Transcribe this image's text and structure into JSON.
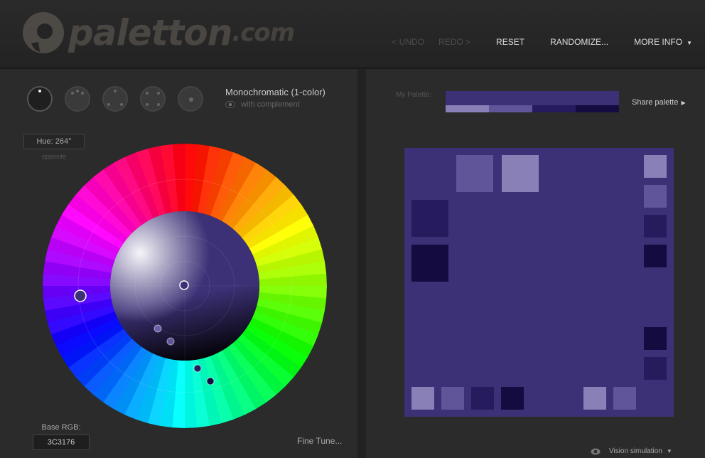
{
  "header": {
    "logo_text": "paletton",
    "logo_suffix": ".com",
    "nav": {
      "undo": "< UNDO",
      "redo": "REDO >",
      "reset": "RESET",
      "randomize": "RANDOMIZE...",
      "more_info": "MORE INFO"
    }
  },
  "scheme": {
    "name": "Monochromatic (1-color)",
    "complement_label": "with complement",
    "icons": [
      "mono-scheme-icon",
      "adjacent-scheme-icon",
      "triad-scheme-icon",
      "tetrad-scheme-icon",
      "freestyle-scheme-icon"
    ]
  },
  "hue": {
    "label": "Hue: 264°",
    "opposite": "opposite"
  },
  "base": {
    "label": "Base RGB:",
    "value": "3C3176"
  },
  "fine_tune": "Fine Tune...",
  "palette": {
    "label": "My Palette:",
    "share": "Share palette",
    "main_color": "#3C3176",
    "swatches": [
      "#8A80B8",
      "#5F5598",
      "#261B5C",
      "#140B40"
    ]
  },
  "preview": {
    "background": "#3C3176",
    "colors": {
      "lightest": "#8A80B8",
      "light": "#5F5598",
      "dark": "#261B5C",
      "darkest": "#140B40"
    }
  },
  "vision": {
    "label": "Vision simulation"
  },
  "colors": {
    "accent": "#3C3176",
    "panel_bg": "#2B2B2B",
    "header_bg": "#272727"
  }
}
